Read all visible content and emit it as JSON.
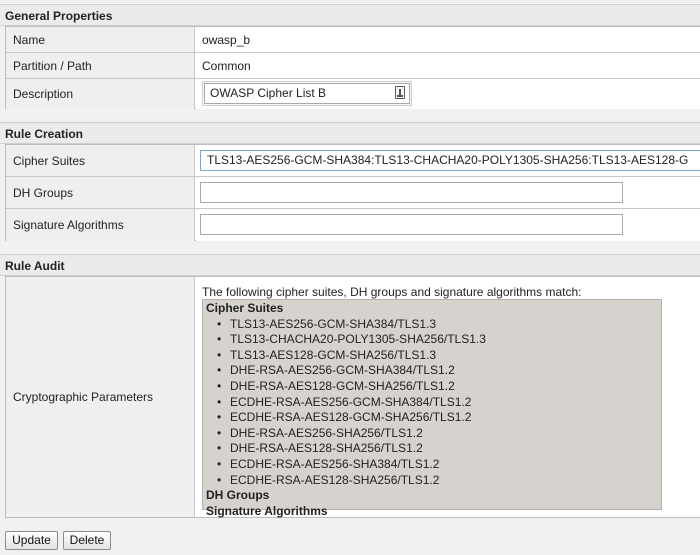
{
  "general": {
    "title": "General Properties",
    "name_label": "Name",
    "name_value": "owasp_b",
    "partition_label": "Partition / Path",
    "partition_value": "Common",
    "description_label": "Description",
    "description_value": "OWASP Cipher List B"
  },
  "rule_creation": {
    "title": "Rule Creation",
    "cipher_label": "Cipher Suites",
    "cipher_value": "TLS13-AES256-GCM-SHA384:TLS13-CHACHA20-POLY1305-SHA256:TLS13-AES128-G",
    "dh_label": "DH Groups",
    "dh_value": "",
    "sig_label": "Signature Algorithms",
    "sig_value": ""
  },
  "rule_audit": {
    "title": "Rule Audit",
    "crypto_label": "Cryptographic Parameters",
    "intro": "The following cipher suites, DH groups and signature algorithms match:",
    "cipher_heading": "Cipher Suites",
    "ciphers": [
      "TLS13-AES256-GCM-SHA384/TLS1.3",
      "TLS13-CHACHA20-POLY1305-SHA256/TLS1.3",
      "TLS13-AES128-GCM-SHA256/TLS1.3",
      "DHE-RSA-AES256-GCM-SHA384/TLS1.2",
      "DHE-RSA-AES128-GCM-SHA256/TLS1.2",
      "ECDHE-RSA-AES256-GCM-SHA384/TLS1.2",
      "ECDHE-RSA-AES128-GCM-SHA256/TLS1.2",
      "DHE-RSA-AES256-SHA256/TLS1.2",
      "DHE-RSA-AES128-SHA256/TLS1.2",
      "ECDHE-RSA-AES256-SHA384/TLS1.2",
      "ECDHE-RSA-AES128-SHA256/TLS1.2"
    ],
    "dh_heading": "DH Groups",
    "sig_heading": "Signature Algorithms"
  },
  "buttons": {
    "update": "Update",
    "delete": "Delete"
  }
}
